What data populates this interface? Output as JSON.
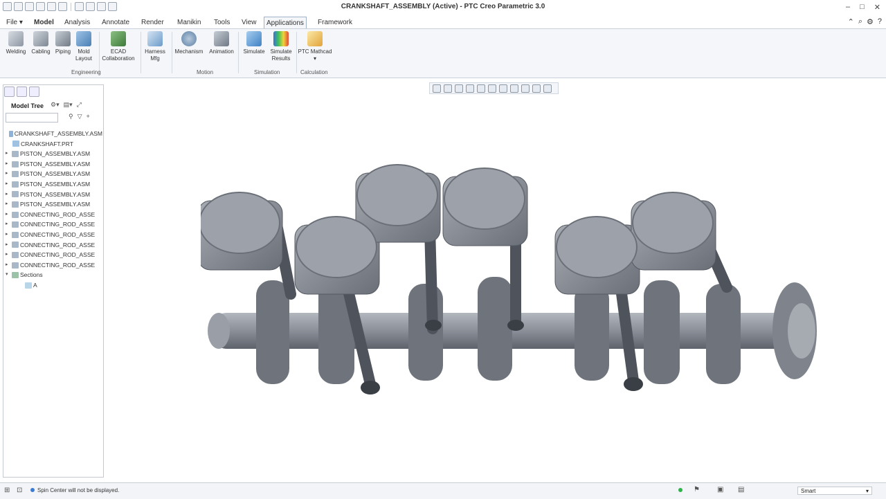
{
  "window": {
    "title": "CRANKSHAFT_ASSEMBLY (Active) - PTC Creo Parametric 3.0"
  },
  "menu": {
    "tabs": [
      "File",
      "Model",
      "Analysis",
      "Annotate",
      "Render",
      "Manikin",
      "Tools",
      "View",
      "Applications",
      "Framework"
    ],
    "active": "Applications"
  },
  "ribbon": {
    "tools": [
      {
        "label": "Welding"
      },
      {
        "label": "Cabling"
      },
      {
        "label": "Piping"
      },
      {
        "label": "Mold Layout"
      },
      {
        "label": "ECAD Collaboration"
      },
      {
        "label": "Harness Mfg"
      },
      {
        "label": "Mechanism"
      },
      {
        "label": "Animation"
      },
      {
        "label": "Simulate"
      },
      {
        "label": "Simulate Results"
      },
      {
        "label": "PTC Mathcad"
      }
    ],
    "groups": [
      "Engineering",
      "Motion",
      "Simulation",
      "Calculation"
    ]
  },
  "model_tree": {
    "header": "Model Tree",
    "items": [
      "CRANKSHAFT_ASSEMBLY.ASM",
      "CRANKSHAFT.PRT",
      "PISTON_ASSEMBLY.ASM",
      "PISTON_ASSEMBLY.ASM",
      "PISTON_ASSEMBLY.ASM",
      "PISTON_ASSEMBLY.ASM",
      "PISTON_ASSEMBLY.ASM",
      "PISTON_ASSEMBLY.ASM",
      "CONNECTING_ROD_ASSE",
      "CONNECTING_ROD_ASSE",
      "CONNECTING_ROD_ASSE",
      "CONNECTING_ROD_ASSE",
      "CONNECTING_ROD_ASSE",
      "CONNECTING_ROD_ASSE",
      "Sections",
      "A"
    ]
  },
  "status": {
    "message": "Spin Center will not be displayed.",
    "filter": "Smart"
  },
  "colors": {
    "ribbon_bg": "#f4f6f9",
    "model_gray": "#8a8f98",
    "model_dark": "#5d626b",
    "active_tab_border": "#9fb2c8"
  }
}
